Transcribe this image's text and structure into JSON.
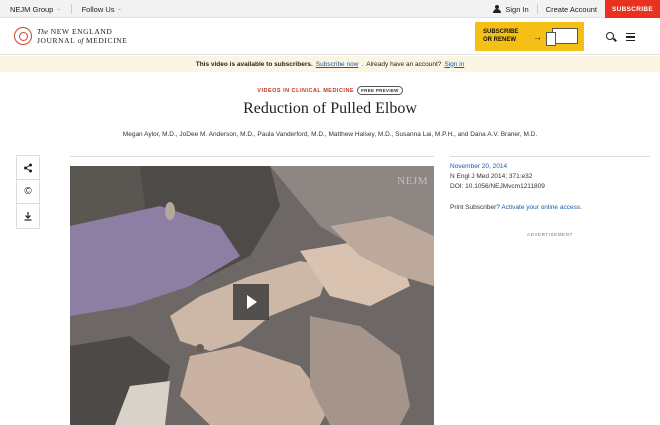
{
  "topbar": {
    "group_label": "NEJM Group",
    "follow_label": "Follow Us",
    "signin_label": "Sign In",
    "create_account_label": "Create Account",
    "subscribe_label": "SUBSCRIBE"
  },
  "header": {
    "logo_the": "The",
    "logo_line1": "NEW ENGLAND",
    "logo_line2a": "JOURNAL",
    "logo_of": "of",
    "logo_line2b": "MEDICINE",
    "promo_line1": "SUBSCRIBE",
    "promo_line2": "OR RENEW"
  },
  "notice": {
    "text": "This video is available to subscribers.",
    "subscribe_link": "Subscribe now",
    "account_text": "Already have an account?",
    "signin_link": "Sign in"
  },
  "article": {
    "kicker": "VIDEOS IN CLINICAL MEDICINE",
    "badge": "FREE PREVIEW",
    "title": "Reduction of Pulled Elbow",
    "authors": "Megan Aylor, M.D., JoDee M. Anderson, M.D., Paula Vanderford, M.D., Matthew Halsey, M.D., Susanna Lai, M.P.H., and Dana A.V. Braner, M.D."
  },
  "video": {
    "watermark": "NEJM"
  },
  "meta": {
    "date": "November 20, 2014",
    "citation": "N Engl J Med 2014; 371:e32",
    "doi": "DOI: 10.1056/NEJMvcm1211809",
    "print_text": "Print Subscriber?",
    "activate_link": "Activate your online access.",
    "ad_label": "ADVERTISEMENT"
  },
  "colors": {
    "accent_red": "#e8321f",
    "link_blue": "#1a5aa8",
    "promo_yellow": "#f5c016",
    "notice_bg": "#fbf6e3"
  }
}
